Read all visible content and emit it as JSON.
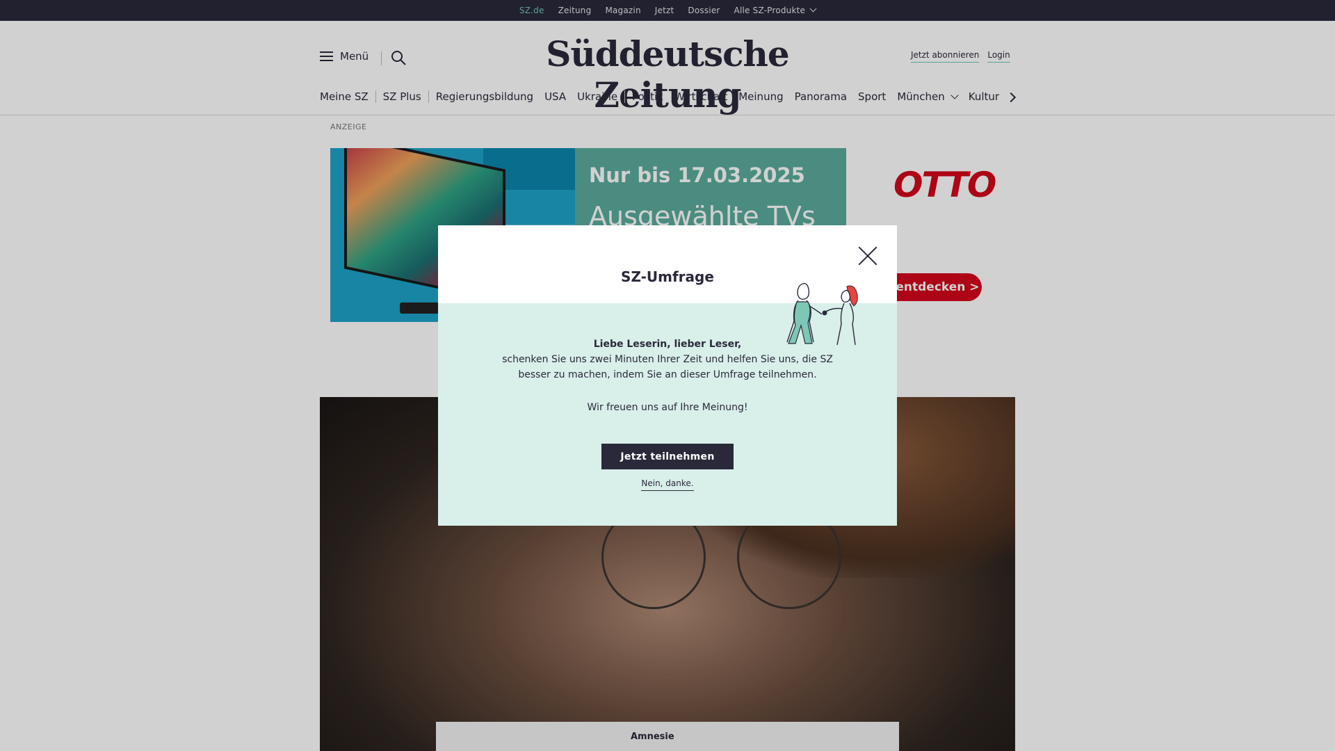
{
  "topbar": {
    "items": [
      {
        "label": "SZ.de"
      },
      {
        "label": "Zeitung"
      },
      {
        "label": "Magazin"
      },
      {
        "label": "Jetzt"
      },
      {
        "label": "Dossier"
      },
      {
        "label": "Alle SZ-Produkte"
      }
    ],
    "active_color": "#71c5b5"
  },
  "header": {
    "menu_label": "Menü",
    "logo": "Süddeutsche Zeitung",
    "subscribe": "Jetzt abonnieren",
    "login": "Login"
  },
  "nav": {
    "items": [
      {
        "label": "Meine SZ"
      },
      {
        "label": "SZ Plus"
      },
      {
        "label": "Regierungsbildung"
      },
      {
        "label": "USA"
      },
      {
        "label": "Ukraine"
      },
      {
        "label": "Politik"
      },
      {
        "label": "Wirtschaft"
      },
      {
        "label": "Meinung"
      },
      {
        "label": "Panorama"
      },
      {
        "label": "Sport"
      },
      {
        "label": "München"
      },
      {
        "label": "Kultur"
      }
    ]
  },
  "ad": {
    "label": "ANZEIGE",
    "headline": "Nur bis 17.03.2025",
    "subline": "Ausgewählte TVs",
    "brand": "OTTO",
    "cta": "Jetzt entdecken >",
    "brand_color": "#d4061c",
    "panel_color": "#5bab9d"
  },
  "article": {
    "teaser_label": "Amnesie"
  },
  "modal": {
    "title": "SZ-Umfrage",
    "greeting": "Liebe Leserin, lieber Leser,",
    "line1": "schenken Sie uns zwei Minuten Ihrer Zeit und helfen Sie uns, die SZ",
    "line2": "besser zu machen, indem Sie an dieser Umfrage teilnehmen.",
    "thanks": "Wir freuen uns auf Ihre Meinung!",
    "cta": "Jetzt teilnehmen",
    "decline": "Nein, danke.",
    "background": "#d9efea"
  }
}
